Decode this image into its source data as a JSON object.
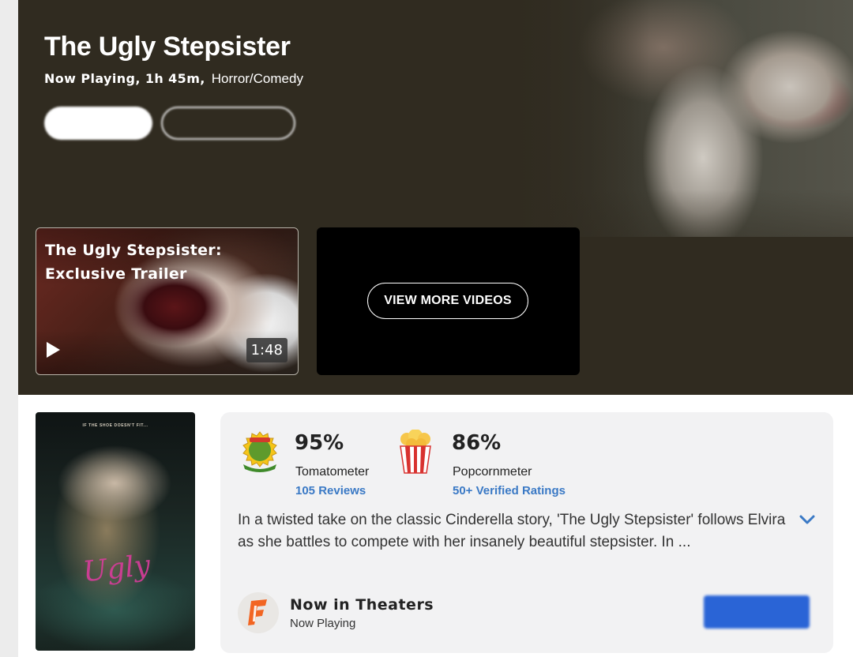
{
  "hero": {
    "title": "The Ugly Stepsister",
    "status": "Now Playing, 1h 45m,",
    "genre": "Horror/Comedy",
    "pills": [
      "",
      ""
    ]
  },
  "trailer": {
    "title": "The Ugly Stepsister: Exclusive Trailer",
    "duration": "1:48",
    "play_icon": "play-icon"
  },
  "more_videos": {
    "label": "VIEW MORE VIDEOS"
  },
  "poster": {
    "tagline": "IF THE SHOE DOESN'T FIT...",
    "title_art": "Ugly"
  },
  "scores": {
    "tomatometer": {
      "value": "95%",
      "label": "Tomatometer",
      "link": "105 Reviews",
      "icon": "certified-fresh-icon"
    },
    "popcornmeter": {
      "value": "86%",
      "label": "Popcornmeter",
      "link": "50+ Verified Ratings",
      "icon": "popcorn-bucket-icon"
    }
  },
  "synopsis": {
    "text": "In a twisted take on the classic Cinderella story, 'The Ugly Stepsister' follows Elvira as she battles to compete with her insanely beautiful stepsister. In ...",
    "expand_icon": "chevron-down-icon"
  },
  "theaters": {
    "title": "Now in Theaters",
    "subtitle": "Now Playing",
    "logo_icon": "fandango-icon",
    "button_label": ""
  },
  "colors": {
    "hero_bg": "#302b20",
    "link_blue": "#3a79c5",
    "ticket_blue": "#2a64d6",
    "panel_bg": "#f2f2f3"
  }
}
